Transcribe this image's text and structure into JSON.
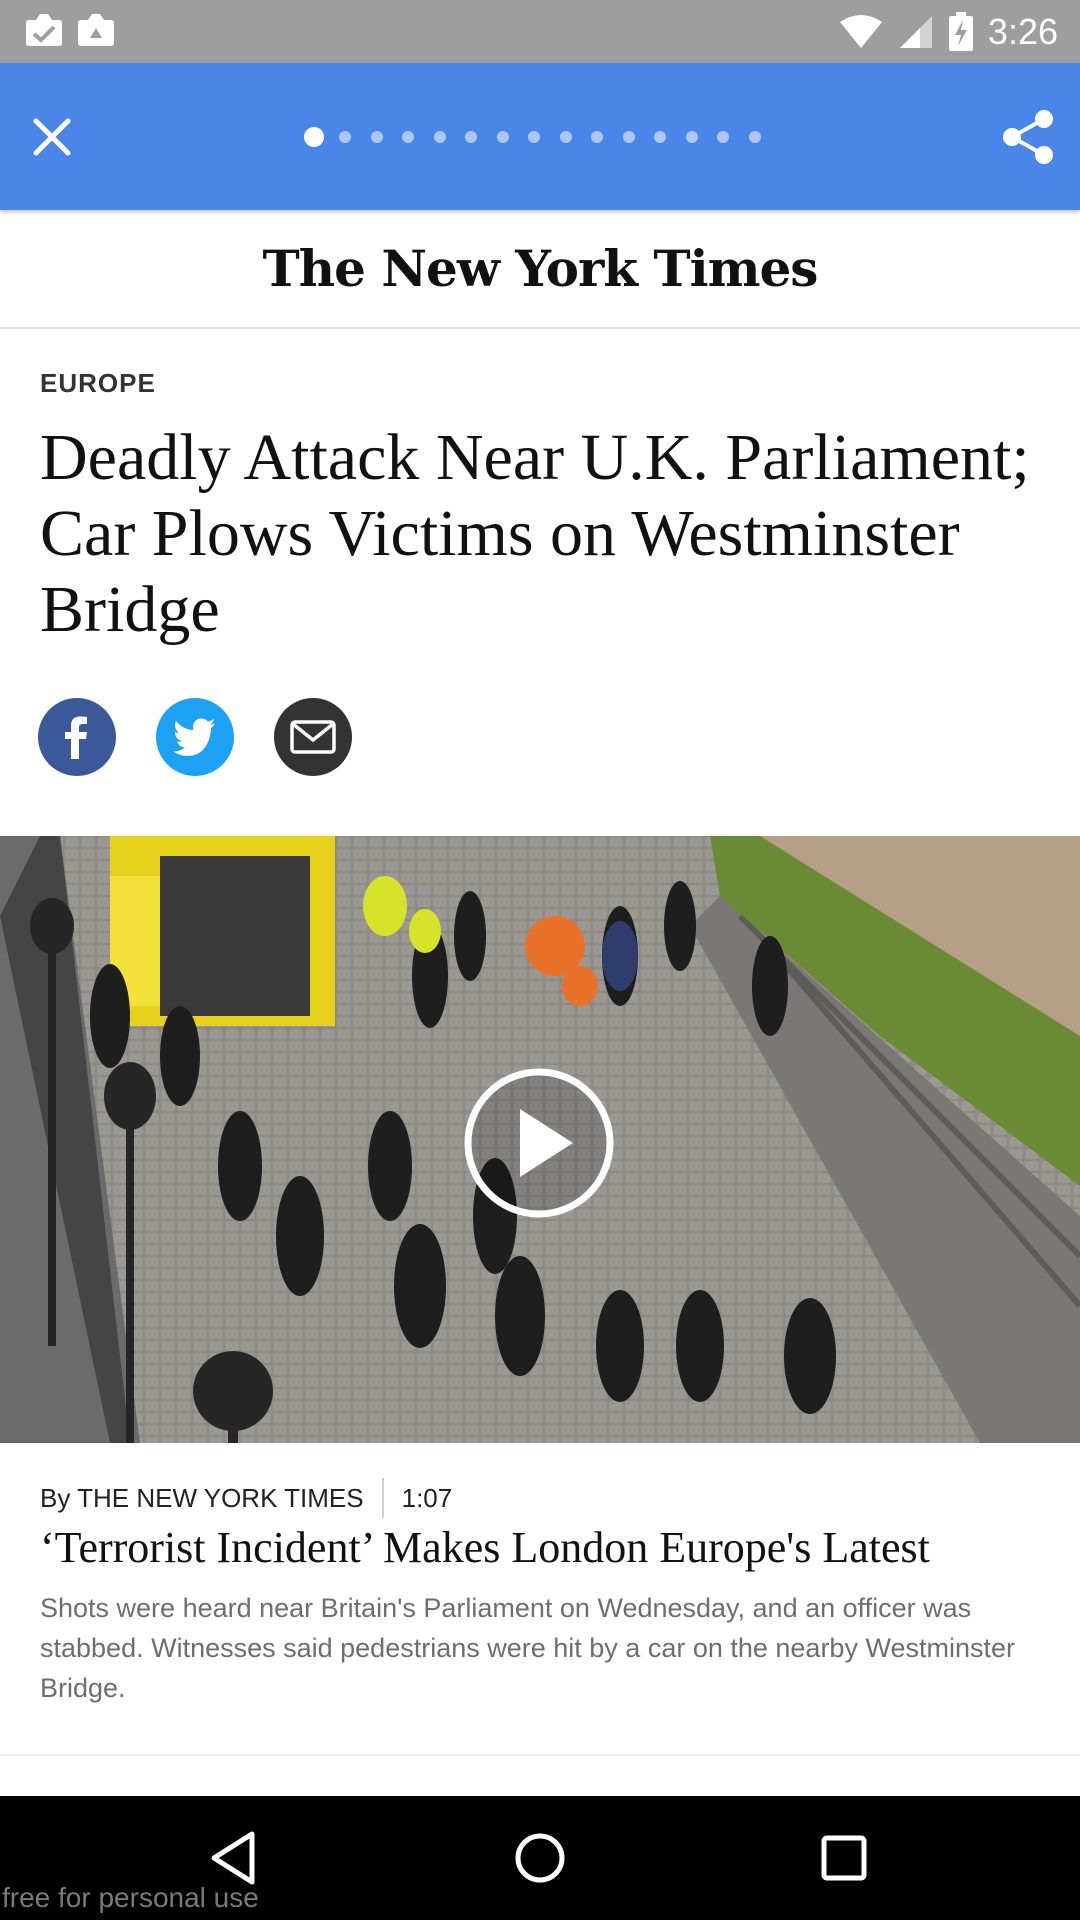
{
  "status_bar": {
    "time": "3:26"
  },
  "app_bar": {
    "close_icon": "close-icon",
    "share_icon": "share-icon",
    "pager": {
      "total": 15,
      "active_index": 0
    }
  },
  "masthead": {
    "logo_text": "The New York Times"
  },
  "article": {
    "section": "EUROPE",
    "headline": "Deadly Attack Near U.K. Parliament; Car Plows Victims on Westminster Bridge",
    "share_buttons": [
      "facebook-icon",
      "twitter-icon",
      "email-icon"
    ],
    "colors": {
      "facebook": "#3b5998",
      "twitter": "#1da1f2",
      "email": "#333333",
      "app_bar": "#4a86e8"
    }
  },
  "video": {
    "byline": "By THE NEW YORK TIMES",
    "duration": "1:07",
    "title": "‘Terrorist Incident’ Makes London Europe's Latest",
    "summary": "Shots were heard near Britain's Parliament on Wednesday, and an officer was stabbed. Witnesses said pedestrians were hit by a car on the nearby Westminster Bridge."
  },
  "watermark": "free for personal use"
}
